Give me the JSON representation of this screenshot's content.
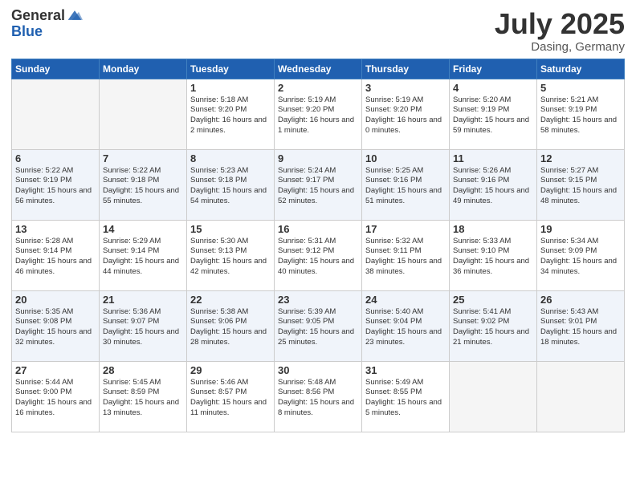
{
  "logo": {
    "general": "General",
    "blue": "Blue"
  },
  "title": "July 2025",
  "location": "Dasing, Germany",
  "weekdays": [
    "Sunday",
    "Monday",
    "Tuesday",
    "Wednesday",
    "Thursday",
    "Friday",
    "Saturday"
  ],
  "weeks": [
    [
      {
        "day": "",
        "empty": true
      },
      {
        "day": "",
        "empty": true
      },
      {
        "day": "1",
        "sunrise": "Sunrise: 5:18 AM",
        "sunset": "Sunset: 9:20 PM",
        "daylight": "Daylight: 16 hours and 2 minutes."
      },
      {
        "day": "2",
        "sunrise": "Sunrise: 5:19 AM",
        "sunset": "Sunset: 9:20 PM",
        "daylight": "Daylight: 16 hours and 1 minute."
      },
      {
        "day": "3",
        "sunrise": "Sunrise: 5:19 AM",
        "sunset": "Sunset: 9:20 PM",
        "daylight": "Daylight: 16 hours and 0 minutes."
      },
      {
        "day": "4",
        "sunrise": "Sunrise: 5:20 AM",
        "sunset": "Sunset: 9:19 PM",
        "daylight": "Daylight: 15 hours and 59 minutes."
      },
      {
        "day": "5",
        "sunrise": "Sunrise: 5:21 AM",
        "sunset": "Sunset: 9:19 PM",
        "daylight": "Daylight: 15 hours and 58 minutes."
      }
    ],
    [
      {
        "day": "6",
        "sunrise": "Sunrise: 5:22 AM",
        "sunset": "Sunset: 9:19 PM",
        "daylight": "Daylight: 15 hours and 56 minutes."
      },
      {
        "day": "7",
        "sunrise": "Sunrise: 5:22 AM",
        "sunset": "Sunset: 9:18 PM",
        "daylight": "Daylight: 15 hours and 55 minutes."
      },
      {
        "day": "8",
        "sunrise": "Sunrise: 5:23 AM",
        "sunset": "Sunset: 9:18 PM",
        "daylight": "Daylight: 15 hours and 54 minutes."
      },
      {
        "day": "9",
        "sunrise": "Sunrise: 5:24 AM",
        "sunset": "Sunset: 9:17 PM",
        "daylight": "Daylight: 15 hours and 52 minutes."
      },
      {
        "day": "10",
        "sunrise": "Sunrise: 5:25 AM",
        "sunset": "Sunset: 9:16 PM",
        "daylight": "Daylight: 15 hours and 51 minutes."
      },
      {
        "day": "11",
        "sunrise": "Sunrise: 5:26 AM",
        "sunset": "Sunset: 9:16 PM",
        "daylight": "Daylight: 15 hours and 49 minutes."
      },
      {
        "day": "12",
        "sunrise": "Sunrise: 5:27 AM",
        "sunset": "Sunset: 9:15 PM",
        "daylight": "Daylight: 15 hours and 48 minutes."
      }
    ],
    [
      {
        "day": "13",
        "sunrise": "Sunrise: 5:28 AM",
        "sunset": "Sunset: 9:14 PM",
        "daylight": "Daylight: 15 hours and 46 minutes."
      },
      {
        "day": "14",
        "sunrise": "Sunrise: 5:29 AM",
        "sunset": "Sunset: 9:14 PM",
        "daylight": "Daylight: 15 hours and 44 minutes."
      },
      {
        "day": "15",
        "sunrise": "Sunrise: 5:30 AM",
        "sunset": "Sunset: 9:13 PM",
        "daylight": "Daylight: 15 hours and 42 minutes."
      },
      {
        "day": "16",
        "sunrise": "Sunrise: 5:31 AM",
        "sunset": "Sunset: 9:12 PM",
        "daylight": "Daylight: 15 hours and 40 minutes."
      },
      {
        "day": "17",
        "sunrise": "Sunrise: 5:32 AM",
        "sunset": "Sunset: 9:11 PM",
        "daylight": "Daylight: 15 hours and 38 minutes."
      },
      {
        "day": "18",
        "sunrise": "Sunrise: 5:33 AM",
        "sunset": "Sunset: 9:10 PM",
        "daylight": "Daylight: 15 hours and 36 minutes."
      },
      {
        "day": "19",
        "sunrise": "Sunrise: 5:34 AM",
        "sunset": "Sunset: 9:09 PM",
        "daylight": "Daylight: 15 hours and 34 minutes."
      }
    ],
    [
      {
        "day": "20",
        "sunrise": "Sunrise: 5:35 AM",
        "sunset": "Sunset: 9:08 PM",
        "daylight": "Daylight: 15 hours and 32 minutes."
      },
      {
        "day": "21",
        "sunrise": "Sunrise: 5:36 AM",
        "sunset": "Sunset: 9:07 PM",
        "daylight": "Daylight: 15 hours and 30 minutes."
      },
      {
        "day": "22",
        "sunrise": "Sunrise: 5:38 AM",
        "sunset": "Sunset: 9:06 PM",
        "daylight": "Daylight: 15 hours and 28 minutes."
      },
      {
        "day": "23",
        "sunrise": "Sunrise: 5:39 AM",
        "sunset": "Sunset: 9:05 PM",
        "daylight": "Daylight: 15 hours and 25 minutes."
      },
      {
        "day": "24",
        "sunrise": "Sunrise: 5:40 AM",
        "sunset": "Sunset: 9:04 PM",
        "daylight": "Daylight: 15 hours and 23 minutes."
      },
      {
        "day": "25",
        "sunrise": "Sunrise: 5:41 AM",
        "sunset": "Sunset: 9:02 PM",
        "daylight": "Daylight: 15 hours and 21 minutes."
      },
      {
        "day": "26",
        "sunrise": "Sunrise: 5:43 AM",
        "sunset": "Sunset: 9:01 PM",
        "daylight": "Daylight: 15 hours and 18 minutes."
      }
    ],
    [
      {
        "day": "27",
        "sunrise": "Sunrise: 5:44 AM",
        "sunset": "Sunset: 9:00 PM",
        "daylight": "Daylight: 15 hours and 16 minutes."
      },
      {
        "day": "28",
        "sunrise": "Sunrise: 5:45 AM",
        "sunset": "Sunset: 8:59 PM",
        "daylight": "Daylight: 15 hours and 13 minutes."
      },
      {
        "day": "29",
        "sunrise": "Sunrise: 5:46 AM",
        "sunset": "Sunset: 8:57 PM",
        "daylight": "Daylight: 15 hours and 11 minutes."
      },
      {
        "day": "30",
        "sunrise": "Sunrise: 5:48 AM",
        "sunset": "Sunset: 8:56 PM",
        "daylight": "Daylight: 15 hours and 8 minutes."
      },
      {
        "day": "31",
        "sunrise": "Sunrise: 5:49 AM",
        "sunset": "Sunset: 8:55 PM",
        "daylight": "Daylight: 15 hours and 5 minutes."
      },
      {
        "day": "",
        "empty": true
      },
      {
        "day": "",
        "empty": true
      }
    ]
  ]
}
